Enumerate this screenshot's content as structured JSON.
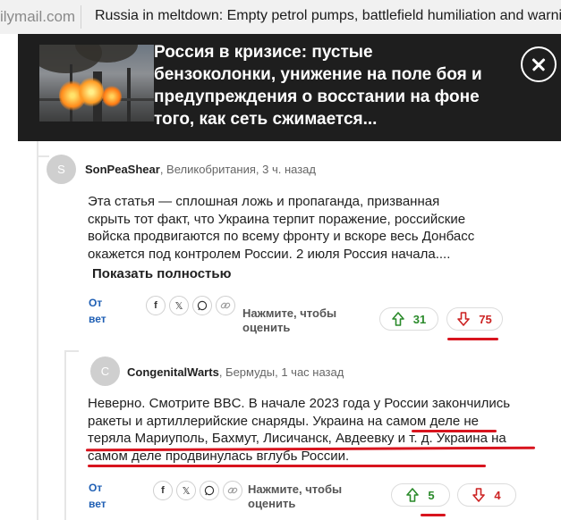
{
  "browser": {
    "domain": "ilymail.com",
    "page_title": "Russia in meltdown: Empty petrol pumps, battlefield humiliation and warnings of uprising"
  },
  "banner": {
    "headline": "Россия в кризисе: пустые бензоколонки, унижение на поле боя и предупреждения о восстании на фоне того, как сеть сжимается..."
  },
  "comments": [
    {
      "avatar_letter": "S",
      "author": "SonPeaShear",
      "meta": ", Великобритания, 3 ч. назад",
      "text": "Эта статья — сплошная ложь и пропаганда, призванная скрыть тот факт, что Украина терпит поражение, российские войска продвигаются по всему фронту и вскоре весь Донбасс окажется под контролем России. 2 июля Россия начала....",
      "show_more": "Показать полностью",
      "reply": "Ответ",
      "rate_prompt": "Нажмите, чтобы оценить",
      "upvotes": "31",
      "downvotes": "75"
    },
    {
      "avatar_letter": "C",
      "author": "CongenitalWarts",
      "meta": ", Бермуды, 1 час назад",
      "text_plain": "Неверно. Смотрите BBC. В начале 2023 года у России закончились ракеты и артиллерийские снаряды. ",
      "text_highlight": "Украина на самом деле не теряла Мариуполь, Бахмут, Лисичанск, Авдеевку и т. д. Украина на самом деле продвинулась вглубь России.",
      "reply": "Ответ",
      "rate_prompt": "Нажмите, чтобы оценить",
      "upvotes": "5",
      "downvotes": "4"
    }
  ],
  "share_icons": [
    "facebook-icon",
    "x-icon",
    "whatsapp-icon",
    "link-icon"
  ],
  "colors": {
    "banner_bg": "#1e1e1e",
    "reply_link": "#1f5fb4",
    "upvote": "#2a8a2a",
    "downvote": "#cc2222",
    "annotation_red": "#d8141e"
  }
}
